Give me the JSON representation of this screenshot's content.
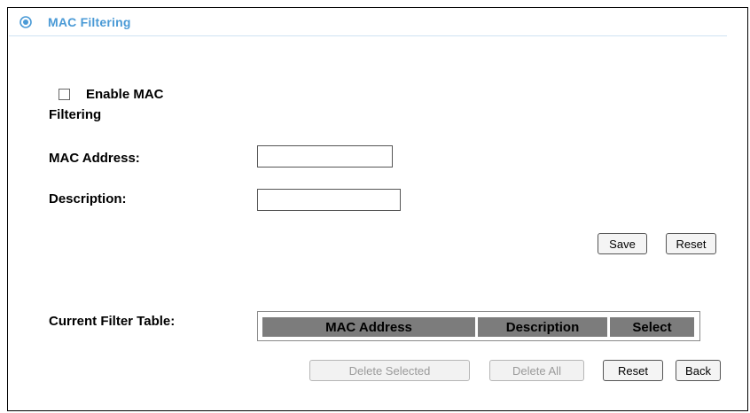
{
  "header": {
    "title": "MAC Filtering",
    "icon": "target-icon",
    "accent": "#4a9ad6"
  },
  "form": {
    "enable_label": "Enable MAC Filtering",
    "enable_checked": false,
    "mac_label": "MAC Address:",
    "mac_value": "",
    "description_label": "Description:",
    "description_value": ""
  },
  "buttons": {
    "save": "Save",
    "reset_form": "Reset",
    "delete_selected": "Delete Selected",
    "delete_all": "Delete All",
    "reset_table": "Reset",
    "back": "Back"
  },
  "table": {
    "label": "Current Filter Table:",
    "columns": [
      "MAC Address",
      "Description",
      "Select"
    ],
    "header_color": "#7c7c7c",
    "rows": []
  }
}
